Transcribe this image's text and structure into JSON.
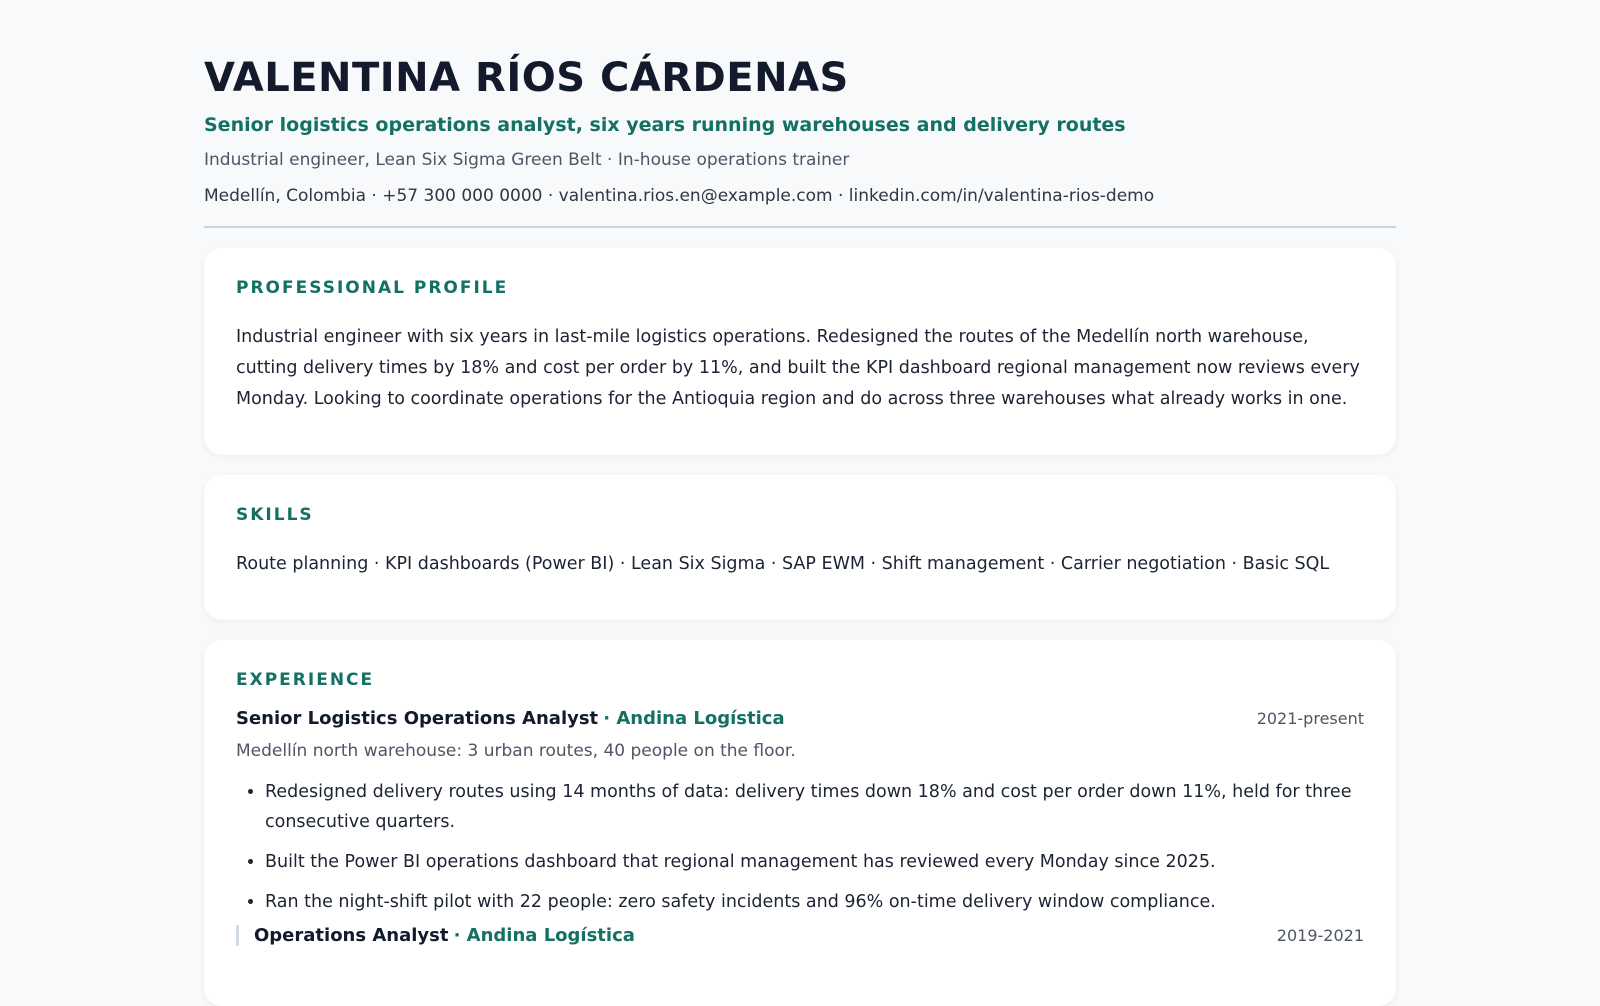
{
  "header": {
    "name": "VALENTINA RÍOS CÁRDENAS",
    "headline": "Senior logistics operations analyst, six years running warehouses and delivery routes",
    "credentials": "Industrial engineer, Lean Six Sigma Green Belt · In-house operations trainer",
    "contact": "Medellín, Colombia · +57 300 000 0000 · valentina.rios.en@example.com · linkedin.com/in/valentina-rios-demo"
  },
  "profile": {
    "title": "PROFESSIONAL PROFILE",
    "text": "Industrial engineer with six years in last-mile logistics operations. Redesigned the routes of the Medellín north warehouse, cutting delivery times by 18% and cost per order by 11%, and built the KPI dashboard regional management now reviews every Monday. Looking to coordinate operations for the Antioquia region and do across three warehouses what already works in one."
  },
  "skills": {
    "title": "SKILLS",
    "text": "Route planning · KPI dashboards (Power BI) · Lean Six Sigma · SAP EWM · Shift management · Carrier negotiation · Basic SQL"
  },
  "experience": {
    "title": "EXPERIENCE",
    "jobs": [
      {
        "title": "Senior Logistics Operations Analyst",
        "company": "· Andina Logística",
        "dates": "2021-present",
        "description": "Medellín north warehouse: 3 urban routes, 40 people on the floor.",
        "bullets": [
          "Redesigned delivery routes using 14 months of data: delivery times down 18% and cost per order down 11%, held for three consecutive quarters.",
          "Built the Power BI operations dashboard that regional management has reviewed every Monday since 2025.",
          "Ran the night-shift pilot with 22 people: zero safety incidents and 96% on-time delivery window compliance."
        ]
      },
      {
        "title": "Operations Analyst",
        "company": "· Andina Logística",
        "dates": "2019-2021"
      }
    ]
  }
}
